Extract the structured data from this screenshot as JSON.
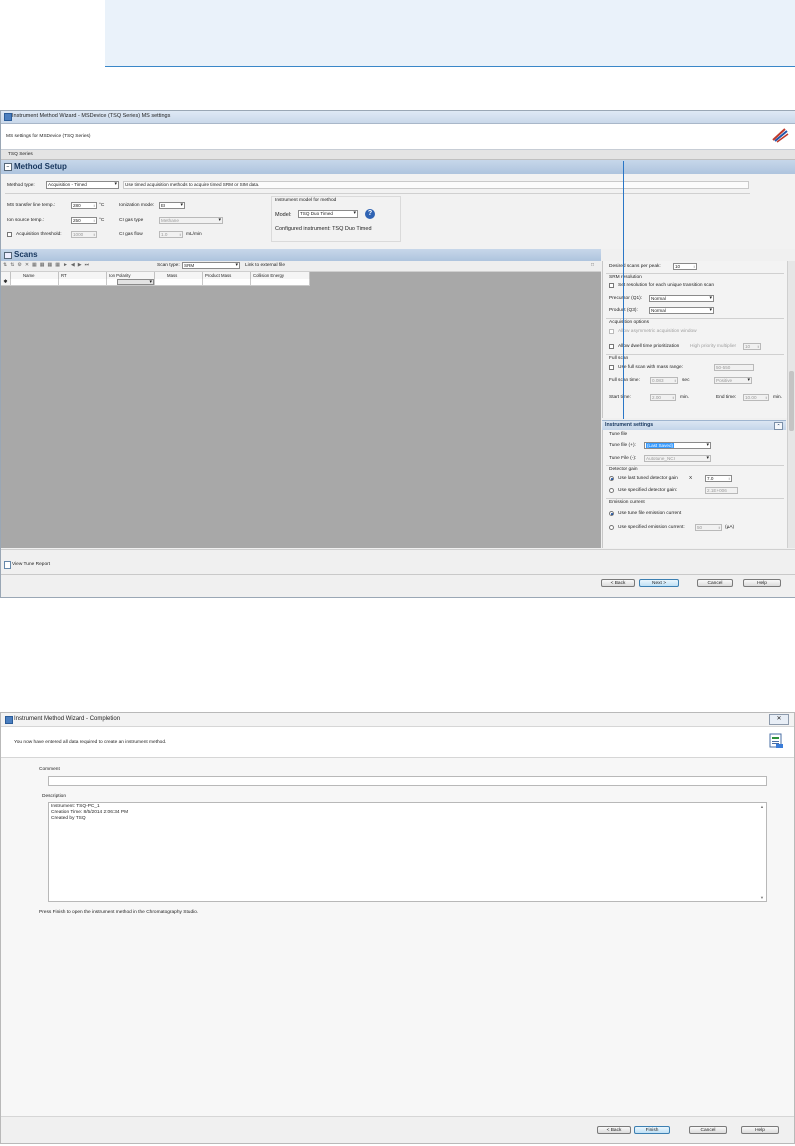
{
  "window1": {
    "title": "Instrument Method Wizard - MSDevice (TSQ Series) MS settings",
    "subtitle": "MS settings for MSDevice (TSQ Series)",
    "tab_label": "TSQ Series",
    "method_setup": {
      "heading": "Method Setup",
      "method_type_label": "Method type:",
      "method_type_value": "Acquisition - Timed",
      "method_description": "Use timed acquisition methods to acquire timed SRM or SIM data.",
      "ms_transfer_label": "MS transfer line temp.:",
      "ms_transfer_value": "280",
      "ion_source_label": "Ion source temp.:",
      "ion_source_value": "250",
      "temp_unit": "°C",
      "acq_threshold_label": "Acquisition threshold:",
      "acq_threshold_value": "1000",
      "ionization_label": "Ionization mode:",
      "ionization_value": "EI",
      "ci_gas_type_label": "CI gas type",
      "ci_gas_type_value": "Methane",
      "ci_gas_flow_label": "CI gas flow",
      "ci_gas_flow_value": "1.0",
      "ci_gas_flow_unit": "mL/min",
      "instrument_model_group": "Instrument model for method",
      "model_label": "Model:",
      "model_value": "TSQ Duo Timed",
      "configured_instrument": "Configured instrument: TSQ Duo Timed"
    },
    "scans": {
      "heading": "Scans",
      "scan_type_label": "Scan type:",
      "scan_type_value": "SRM",
      "link_external": "Link to external file",
      "columns": [
        "Name",
        "RT",
        "Ion Polarity",
        "Mass",
        "Product Mass",
        "Collision Energy"
      ],
      "new_row_marker": "✱"
    },
    "right_panel": {
      "desired_scans_label": "Desired scans per peak:",
      "desired_scans_value": "10",
      "srm_resolution_group": "SRM resolution",
      "set_resolution_label": "Set resolution for each unique transition scan",
      "precursor_label": "Precursor (Q1):",
      "precursor_value": "Normal",
      "product_label": "Product (Q3):",
      "product_value": "Normal",
      "acq_ion_options_group": "Acquisition options",
      "allow_asym_label": "Allow asymmetric acquisition window",
      "allow_dwell_label": "Allow dwell time prioritization",
      "high_priority_label": "High priority multiplier",
      "high_priority_value": "10",
      "full_scan_group": "Full scan",
      "use_full_scan_label": "Use full scan with mass range:",
      "mass_range_value": "50-550",
      "full_scan_time_label": "Full scan time:",
      "full_scan_time_value": "0.083",
      "sec_unit": "sec",
      "polarity_value": "Positive",
      "start_time_label": "Start time:",
      "start_time_value": "2.00",
      "end_time_label": "End time:",
      "end_time_value": "10.00",
      "min_unit": "min."
    },
    "instrument_settings": {
      "heading": "Instrument settings",
      "tune_file_group": "Tune file",
      "tune_file_plus_label": "Tune file (+):",
      "tune_file_plus_value": "(Last Saved)",
      "tune_file_minus_label": "Tune File (-):",
      "tune_file_minus_value": "Autotune_NCI",
      "detector_gain_group": "Detector gain",
      "use_last_tuned_label": "Use last tuned detector gain",
      "x_label": "X",
      "last_tuned_value": "7.0",
      "use_specified_gain_label": "Use specified detector gain:",
      "specified_gain_value": "2.1E+006",
      "emission_group": "Emission current",
      "use_tune_emission_label": "Use tune file emission current",
      "use_specified_emission_label": "Use specified emission current:",
      "specified_emission_value": "50",
      "emission_unit": "(µA)"
    },
    "view_tune_report": "View Tune Report",
    "buttons": {
      "back": "< Back",
      "next": "Next >",
      "cancel": "Cancel",
      "help": "Help"
    }
  },
  "window2": {
    "title": "Instrument Method Wizard - Completion",
    "close_glyph": "✕",
    "intro": "You now have entered all data required to create an instrument method.",
    "comment_label": "Comment",
    "description_label": "Description",
    "description_lines": [
      "Instrument: TSQ-PC_1",
      "Creation Time: 8/5/2014 2:06:34 PM",
      "Created by TSQ"
    ],
    "finish_note": "Press Finish to open the instrument method in the Chromatography Studio.",
    "buttons": {
      "back": "< Back",
      "finish": "Finish",
      "cancel": "Cancel",
      "help": "Help"
    }
  },
  "colors": {
    "accent_blue": "#2a76c6",
    "section_text": "#17365d",
    "grid_gray": "#a8a8a8"
  },
  "icons": [
    "app-icon",
    "wizard-logo-icon",
    "help-icon",
    "toolbar-icons",
    "report-icon",
    "completion-doc-icon"
  ]
}
